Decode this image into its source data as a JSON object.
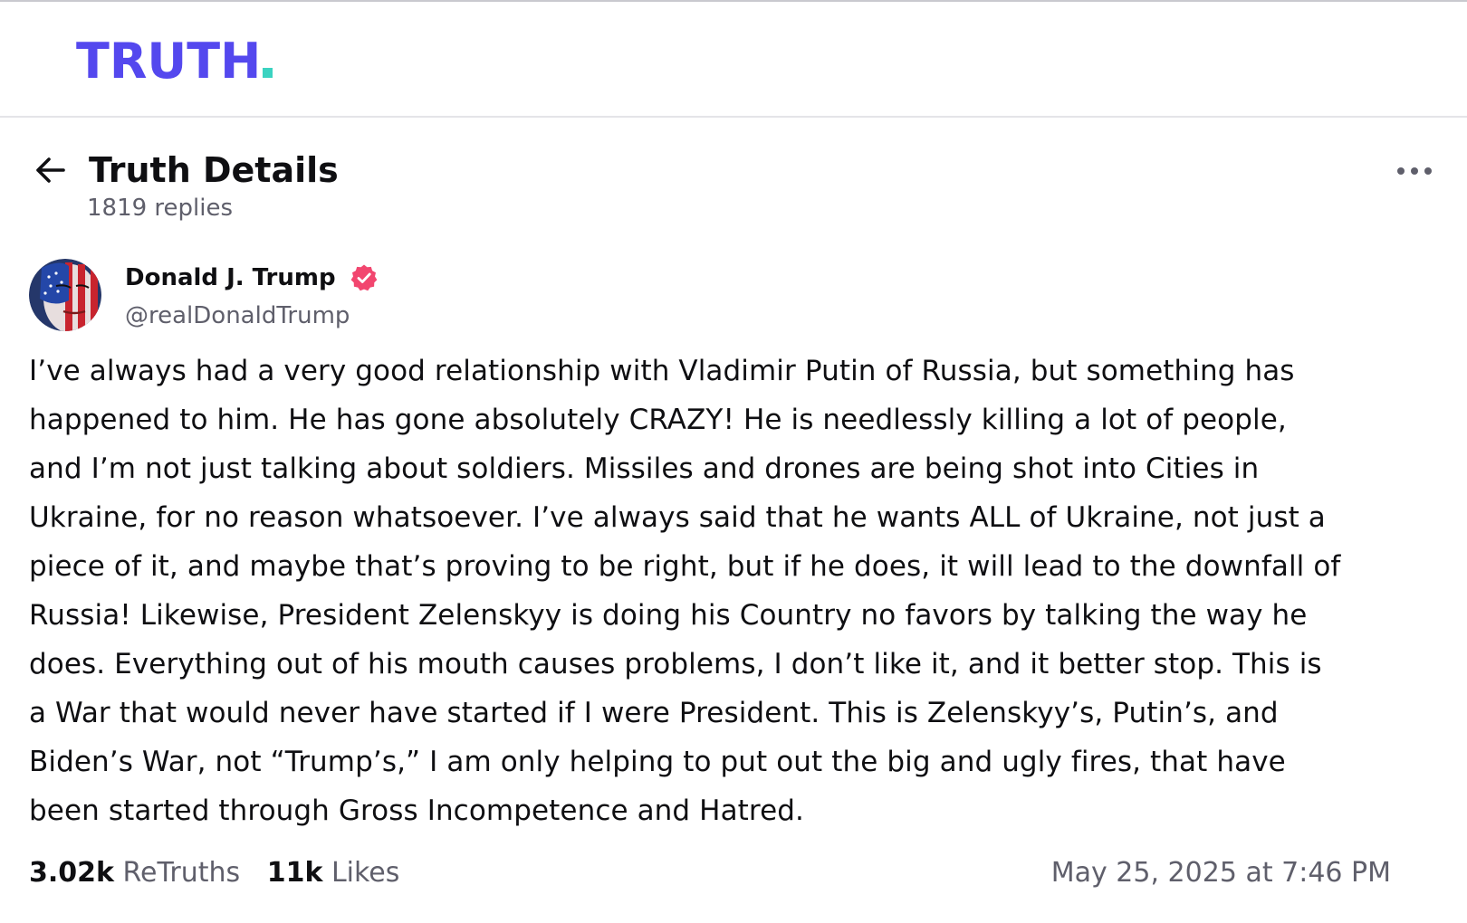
{
  "header": {
    "logo_text": "TRUTH",
    "logo_color": "#5448ee",
    "logo_dot_color": "#3bd3c1"
  },
  "page": {
    "title": "Truth Details",
    "replies": "1819 replies",
    "back_icon": "arrow-left-icon",
    "more_icon": "more-horizontal-icon"
  },
  "author": {
    "name": "Donald J. Trump",
    "handle": "@realDonaldTrump",
    "verified_icon": "verified-badge-icon",
    "verified_color": "#f2466f"
  },
  "post": {
    "lines": [
      "I’ve always had a very good relationship with Vladimir Putin of Russia, but something has",
      "happened to him. He has gone absolutely CRAZY! He is needlessly killing a lot of people,",
      "and I’m not just talking about soldiers. Missiles and drones are being shot into Cities in",
      "Ukraine, for no reason whatsoever. I’ve always said that he wants ALL of Ukraine, not just a",
      "piece of it, and maybe that’s proving to be right, but if he does, it will lead to the downfall of",
      "Russia! Likewise, President Zelenskyy is doing his Country no favors by talking the way he",
      "does. Everything out of his mouth causes problems, I don’t like it, and it better stop. This is",
      "a War that would never have started if I were President. This is Zelenskyy’s, Putin’s, and",
      "Biden’s War, not “Trump’s,” I am only helping to put out the big and ugly fires, that have",
      "been started through Gross Incompetence and Hatred."
    ]
  },
  "stats": {
    "retruths_count": "3.02k",
    "retruths_label": "ReTruths",
    "likes_count": "11k",
    "likes_label": "Likes",
    "timestamp": "May 25, 2025 at 7:46 PM"
  }
}
